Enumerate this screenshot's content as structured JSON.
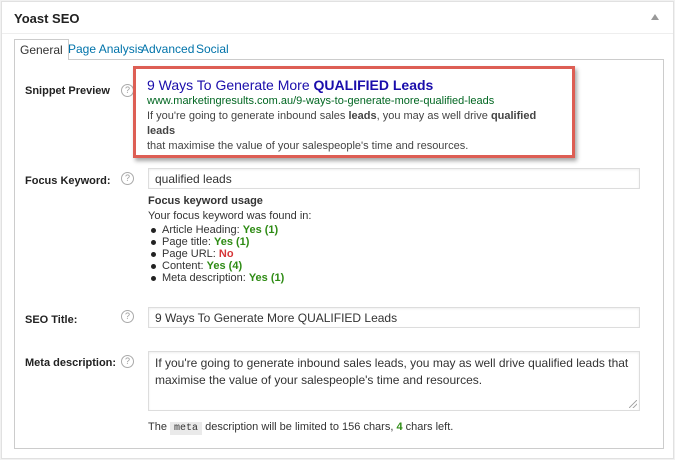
{
  "metabox": {
    "title": "Yoast SEO"
  },
  "tabs": [
    "General",
    "Page Analysis",
    "Advanced",
    "Social"
  ],
  "snippet": {
    "label": "Snippet Preview",
    "title_plain": "9 Ways To Generate More ",
    "title_bold": "QUALIFIED Leads",
    "url": "www.marketingresults.com.au/9-ways-to-generate-more-qualified-leads",
    "desc_1": "If you're going to generate inbound sales ",
    "desc_bold_1": "leads",
    "desc_2": ", you may as well drive ",
    "desc_bold_2": "qualified leads",
    "desc_3": "that maximise the value of your salespeople's time and resources."
  },
  "focus": {
    "label": "Focus Keyword:",
    "value": "qualified leads",
    "usage_heading": "Focus keyword usage",
    "usage_intro": "Your focus keyword was found in:",
    "items": [
      {
        "label": "Article Heading: ",
        "result": "Yes (1)",
        "status": "yes"
      },
      {
        "label": "Page title: ",
        "result": "Yes (1)",
        "status": "yes"
      },
      {
        "label": "Page URL: ",
        "result": "No",
        "status": "no"
      },
      {
        "label": "Content: ",
        "result": "Yes (4)",
        "status": "yes"
      },
      {
        "label": "Meta description: ",
        "result": "Yes (1)",
        "status": "yes"
      }
    ]
  },
  "seo_title": {
    "label": "SEO Title:",
    "value": "9 Ways To Generate More QUALIFIED Leads"
  },
  "meta_desc": {
    "label": "Meta description:",
    "value": "If you're going to generate inbound sales leads, you may as well drive qualified leads that maximise the value of your salespeople's time and resources.",
    "note_before": "The ",
    "note_code": "meta",
    "note_middle": " description will be limited to 156 chars, ",
    "chars_left": "4",
    "note_after": " chars left."
  },
  "help_glyph": "?",
  "colors": {
    "accent": "#0073aa",
    "highlight_border": "#dd5e54",
    "snippet_title": "#1a0dab",
    "snippet_url": "#006621",
    "yes": "#2e8b14",
    "no": "#d63638"
  }
}
